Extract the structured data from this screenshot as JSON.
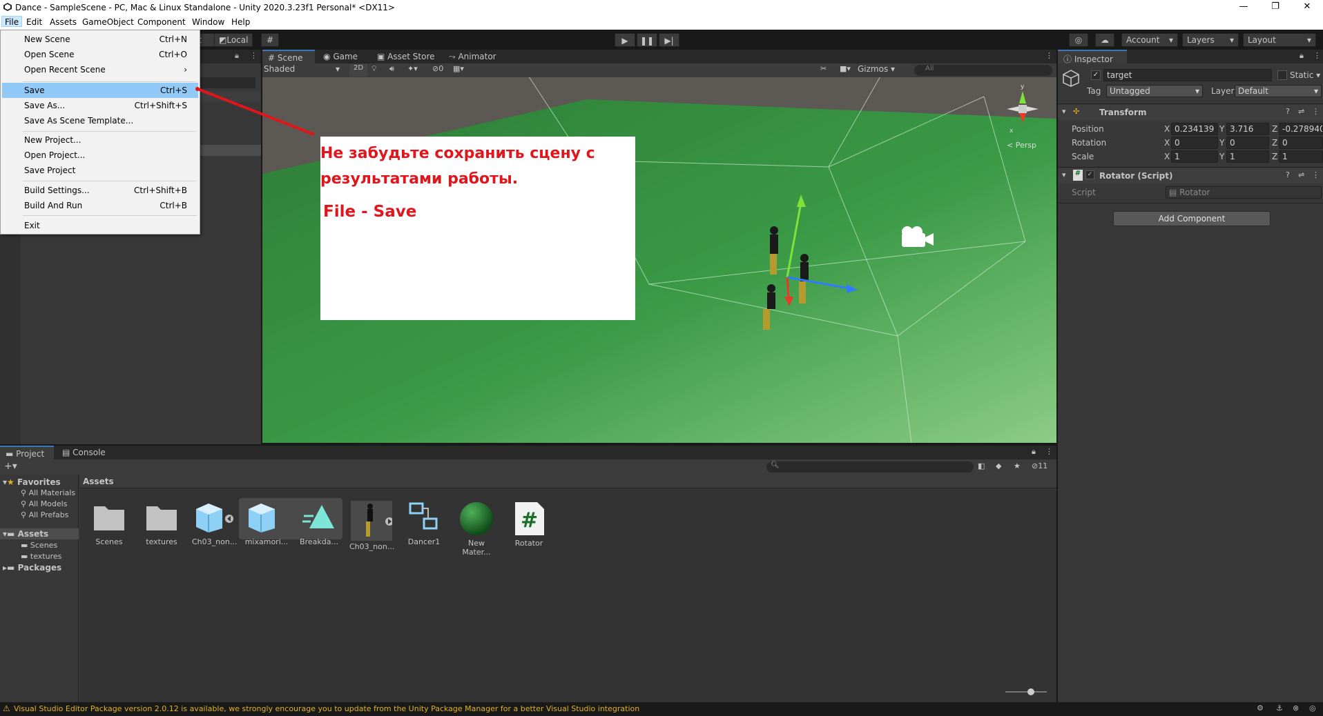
{
  "window": {
    "title": "Dance - SampleScene - PC, Mac & Linux Standalone - Unity 2020.3.23f1 Personal* <DX11>",
    "minimize": "—",
    "maximize": "❐",
    "close": "✕"
  },
  "menubar": [
    "File",
    "Edit",
    "Assets",
    "GameObject",
    "Component",
    "Window",
    "Help"
  ],
  "file_menu": {
    "items": [
      {
        "label": "New Scene",
        "shortcut": "Ctrl+N"
      },
      {
        "label": "Open Scene",
        "shortcut": "Ctrl+O"
      },
      {
        "label": "Open Recent Scene",
        "shortcut": "›"
      },
      {
        "label": "Save",
        "shortcut": "Ctrl+S"
      },
      {
        "label": "Save As...",
        "shortcut": "Ctrl+Shift+S"
      },
      {
        "label": "Save As Scene Template...",
        "shortcut": ""
      },
      {
        "label": "New Project...",
        "shortcut": ""
      },
      {
        "label": "Open Project...",
        "shortcut": ""
      },
      {
        "label": "Save Project",
        "shortcut": ""
      },
      {
        "label": "Build Settings...",
        "shortcut": "Ctrl+Shift+B"
      },
      {
        "label": "Build And Run",
        "shortcut": "Ctrl+B"
      },
      {
        "label": "Exit",
        "shortcut": ""
      }
    ],
    "highlighted": "Save"
  },
  "toolbar": {
    "pivot_partial": "t",
    "local": "Local",
    "account": "Account",
    "layers": "Layers",
    "layout": "Layout"
  },
  "scene_tabs": [
    "Scene",
    "Game",
    "Asset Store",
    "Animator"
  ],
  "scene_toolbar": {
    "shading": "Shaded",
    "twod": "2D",
    "hidden_count": "0",
    "gizmos": "Gizmos",
    "search_placeholder": "All",
    "persp_label": "< Persp"
  },
  "annotation": {
    "line1": "Не забудьте сохранить сцену с",
    "line2": "результатами работы.",
    "line3": "File - Save"
  },
  "inspector": {
    "tab": "Inspector",
    "object_name": "target",
    "static_label": "Static",
    "tag_label": "Tag",
    "tag_value": "Untagged",
    "layer_label": "Layer",
    "layer_value": "Default",
    "transform_title": "Transform",
    "position_label": "Position",
    "rotation_label": "Rotation",
    "scale_label": "Scale",
    "position": {
      "x": "0.234139",
      "y": "3.716",
      "z": "-0.278940"
    },
    "rotation": {
      "x": "0",
      "y": "0",
      "z": "0"
    },
    "scale": {
      "x": "1",
      "y": "1",
      "z": "1"
    },
    "script_component_title": "Rotator (Script)",
    "script_label": "Script",
    "script_value": "Rotator",
    "add_component": "Add Component"
  },
  "bottom_tabs": [
    "Project",
    "Console"
  ],
  "project": {
    "favorites": "Favorites",
    "fav_items": [
      "All Materials",
      "All Models",
      "All Prefabs"
    ],
    "assets_root": "Assets",
    "asset_folders": [
      "Scenes",
      "textures"
    ],
    "packages": "Packages",
    "breadcrumb": "Assets",
    "hidden_count": "11",
    "assets": [
      {
        "name": "Scenes",
        "icon": "folder-icon"
      },
      {
        "name": "textures",
        "icon": "folder-icon"
      },
      {
        "name": "Ch03_non...",
        "icon": "model-icon"
      },
      {
        "name": "mixamori...",
        "icon": "model-icon"
      },
      {
        "name": "Breakda...",
        "icon": "animation-icon"
      },
      {
        "name": "Ch03_non...",
        "icon": "character-thumbnail-icon"
      },
      {
        "name": "Dancer1",
        "icon": "animator-controller-icon"
      },
      {
        "name": "New Mater...",
        "icon": "material-sphere-icon"
      },
      {
        "name": "Rotator",
        "icon": "csharp-script-icon"
      }
    ]
  },
  "status": {
    "message": "Visual Studio Editor Package version 2.0.12 is available, we strongly encourage you to update from the Unity Package Manager for a better Visual Studio integration"
  },
  "colors": {
    "menu_highlight": "#91c9f7",
    "annotation_text": "#e0161d",
    "accent_blue": "#3a79bb",
    "ground_green": "#2f8a3a",
    "warning_yellow": "#e3b31b"
  }
}
